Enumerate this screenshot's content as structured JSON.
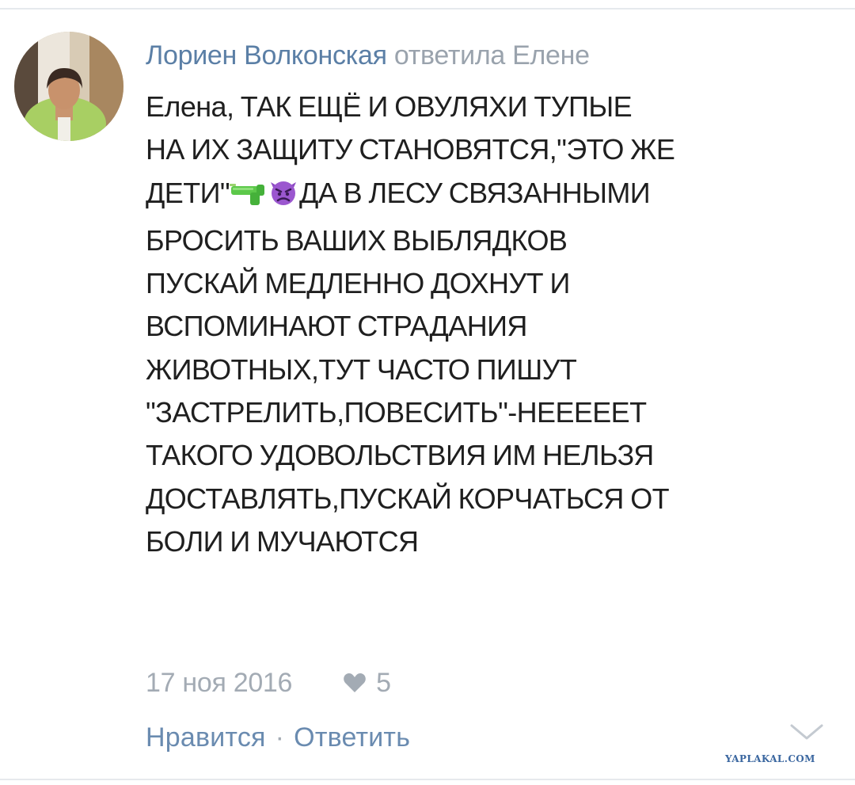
{
  "comment": {
    "author": "Лориен Волконская",
    "reply_to": "ответила Елене",
    "text_lines": [
      "Елена, ТАК ЕЩЁ И ОВУЛЯХИ ТУПЫЕ",
      "НА ИХ ЗАЩИТУ СТАНОВЯТСЯ,\"ЭТО ЖЕ",
      "ДЕТИ\"",
      "ДА В ЛЕСУ СВЯЗАННЫМИ",
      "БРОСИТЬ ВАШИХ ВЫБЛЯДКОВ",
      "ПУСКАЙ МЕДЛЕННО ДОХНУТ И",
      "ВСПОМИНАЮТ СТРАДАНИЯ",
      "ЖИВОТНЫХ,ТУТ ЧАСТО ПИШУТ",
      "\"ЗАСТРЕЛИТЬ,ПОВЕСИТЬ\"-НЕЕЕЕЕТ",
      "ТАКОГО УДОВОЛЬСТВИЯ ИМ НЕЛЬЗЯ",
      "ДОСТАВЛЯТЬ,ПУСКАЙ КОРЧАТЬСЯ ОТ",
      "БОЛИ И МУЧАЮТСЯ"
    ],
    "emojis": [
      "water-pistol-icon",
      "angry-devil-icon"
    ],
    "date": "17 ноя 2016",
    "likes_count": "5",
    "colors": {
      "author": "#5b7fa6",
      "meta": "#a3abb4",
      "text": "#1f1f1f",
      "link": "#6a8bb0"
    }
  },
  "actions": {
    "like_label": "Нравится",
    "separator": "·",
    "reply_label": "Ответить"
  },
  "watermark": "YAPLAKAL.COM"
}
